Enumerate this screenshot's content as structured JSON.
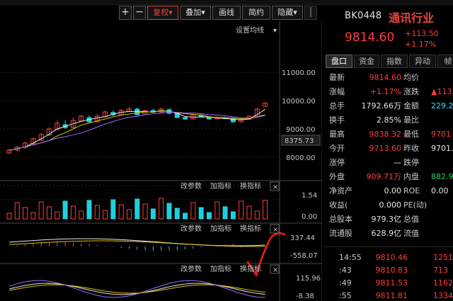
{
  "toolbar": {
    "plus": "+",
    "minus": "−",
    "sep": "|",
    "fuquan": "复权",
    "fuquan_arrow": "▾",
    "diejia": "叠加",
    "diejia_arrow": "▾",
    "huaxian": "画线",
    "jianyue": "简约",
    "yincang": "隐藏",
    "yincang_arrow": "▾",
    "set_ma": "设置均线",
    "set_ma_arrow": "▾"
  },
  "price_axis": {
    "labels": [
      "11000.00",
      "10000.00",
      "9000.00",
      "8000.00"
    ],
    "current_tag": "8375.73"
  },
  "panels": [
    {
      "gai": "改参数",
      "jia": "加指标",
      "huan": "换指标",
      "close": "×",
      "axis": [
        "1.54",
        "0.00"
      ]
    },
    {
      "gai": "改参数",
      "jia": "加指标",
      "huan": "换指标",
      "close": "×",
      "axis": [
        "337.44",
        "-558.07"
      ]
    },
    {
      "gai": "改参数",
      "jia": "加指标",
      "huan": "换指标",
      "close": "×",
      "axis": [
        "115.96",
        "-8.38"
      ]
    }
  ],
  "header": {
    "code": "BK0448",
    "name": "通讯行业",
    "price": "9814.60",
    "change_abs": "+113.50",
    "change_pct": "+1.17%"
  },
  "tabs": [
    "盘口",
    "资金",
    "指数",
    "异动",
    "帧"
  ],
  "quote_rows": [
    {
      "l1": "最新",
      "v1": "9814.60",
      "c1": "red",
      "l2": "均价",
      "v2": "",
      "c2": "red"
    },
    {
      "l1": "涨幅",
      "v1": "+1.17%",
      "c1": "red",
      "l2": "涨跌",
      "v2": "▲113.",
      "c2": "red"
    },
    {
      "l1": "总手",
      "v1": "1792.66万",
      "c1": "white",
      "l2": "金额",
      "v2": "229.22",
      "c2": "cyan"
    },
    {
      "l1": "换手",
      "v1": "2.85%",
      "c1": "white",
      "l2": "最比",
      "v2": "",
      "c2": "white"
    },
    {
      "l1": "最高",
      "v1": "9838.32",
      "c1": "red",
      "l2": "最低",
      "v2": "9701",
      "c2": "red"
    },
    {
      "l1": "今开",
      "v1": "9713.60",
      "c1": "red",
      "l2": "昨收",
      "v2": "9701.",
      "c2": "white"
    },
    {
      "l1": "涨停",
      "v1": "—",
      "c1": "white",
      "l2": "跌停",
      "v2": "",
      "c2": "white"
    },
    {
      "l1": "外盘",
      "v1": "909.71万",
      "c1": "red",
      "l2": "内盘",
      "v2": "882.95",
      "c2": "green"
    },
    {
      "l1": "净资产",
      "v1": "0.00",
      "c1": "white",
      "l2": "ROE",
      "v2": "0.00",
      "c2": "white"
    },
    {
      "l1": "收益(",
      "v1": "0.000",
      "c1": "white",
      "l2": "PE(动)",
      "v2": "",
      "c2": "white"
    },
    {
      "l1": "总股本",
      "v1": "979.3亿",
      "c1": "white",
      "l2": "总值",
      "v2": "",
      "c2": "white"
    },
    {
      "l1": "流通股",
      "v1": "628.9亿",
      "c1": "white",
      "l2": "流值",
      "v2": "",
      "c2": "white"
    }
  ],
  "ticks": [
    {
      "time": "14:55",
      "price": "9810.46",
      "vol": "1251"
    },
    {
      "time": ":43",
      "price": "9810.83",
      "vol": "713"
    },
    {
      "time": ":49",
      "price": "9811.53",
      "vol": "1162"
    },
    {
      "time": ":55",
      "price": "9811.81",
      "vol": "1334"
    }
  ],
  "colors": {
    "up": "#ff3b3b",
    "down": "#1fcfdf",
    "ma1": "#e8e8e8",
    "ma2": "#e8c000",
    "ma3": "#9a6bff",
    "accent": "#e8453c"
  }
}
